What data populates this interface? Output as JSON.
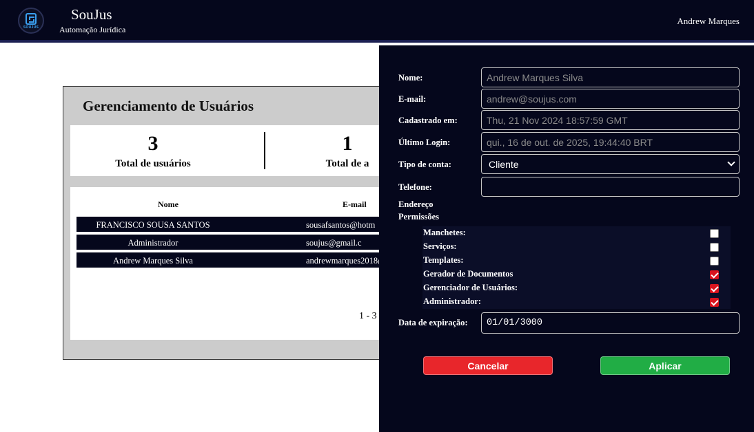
{
  "header": {
    "logo_text": "SOUJUS",
    "brand_name": "SouJus",
    "brand_subtitle": "Automação Jurídica",
    "user_name": "Andrew Marques"
  },
  "panel": {
    "title": "Gerenciamento de Usuários",
    "stats": [
      {
        "value": "3",
        "label": "Total de usuários"
      },
      {
        "value": "1",
        "label": "Total de a"
      }
    ],
    "table": {
      "headers": {
        "name": "Nome",
        "email": "E-mail"
      },
      "rows": [
        {
          "name": "FRANCISCO SOUSA SANTOS",
          "email": "sousafsantos@hotm"
        },
        {
          "name": "Administrador",
          "email": "soujus@gmail.c"
        },
        {
          "name": "Andrew Marques Silva",
          "email": "andrewmarques2018@"
        }
      ]
    },
    "pagination": "1 - 3"
  },
  "drawer": {
    "fields": {
      "nome": {
        "label": "Nome:",
        "placeholder": "Andrew Marques Silva"
      },
      "email": {
        "label": "E-mail:",
        "placeholder": "andrew@soujus.com"
      },
      "cadastrado": {
        "label": "Cadastrado em:",
        "placeholder": "Thu, 21 Nov 2024 18:57:59 GMT"
      },
      "ultimo_login": {
        "label": "Último Login:",
        "placeholder": "qui., 16 de out. de 2025, 19:44:40 BRT"
      },
      "tipo_conta": {
        "label": "Tipo de conta:",
        "value": "Cliente"
      },
      "telefone": {
        "label": "Telefone:",
        "value": ""
      },
      "endereco": {
        "label": "Endereço"
      },
      "permissoes_label": "Permissões",
      "expiracao": {
        "label": "Data de expiração:",
        "value": "01/01/3000"
      }
    },
    "permissions": [
      {
        "label": "Manchetes:",
        "checked": false
      },
      {
        "label": "Serviços:",
        "checked": false
      },
      {
        "label": "Templates:",
        "checked": false
      },
      {
        "label": "Gerador de Documentos",
        "checked": true
      },
      {
        "label": "Gerenciador de Usuários:",
        "checked": true
      },
      {
        "label": "Administrador:",
        "checked": true
      }
    ],
    "buttons": {
      "cancel": "Cancelar",
      "apply": "Aplicar"
    },
    "colors": {
      "cancel": "#e8262b",
      "apply": "#21ad45",
      "checkbox_on": "#d9141e",
      "background": "#05071c"
    }
  }
}
